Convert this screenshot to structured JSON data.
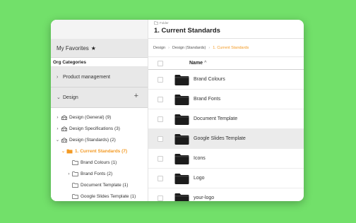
{
  "sidebar": {
    "favorites_label": "My Favorites",
    "org_categories": "Org Categories",
    "sections": [
      {
        "label": "Product management",
        "expanded": false
      },
      {
        "label": "Design",
        "expanded": true
      }
    ],
    "tree": [
      {
        "label": "Design (General) (9)",
        "level": 0,
        "chevron": "right",
        "icon": "library-icon"
      },
      {
        "label": "Design Specifications (3)",
        "level": 0,
        "chevron": "right",
        "icon": "library-icon"
      },
      {
        "label": "Design (Standards) (2)",
        "level": 0,
        "chevron": "down",
        "icon": "library-icon"
      },
      {
        "label": "1. Current Standards (7)",
        "level": 1,
        "chevron": "down",
        "icon": "folder-filled-icon",
        "active": true
      },
      {
        "label": "Brand Colours (1)",
        "level": 2,
        "chevron": "",
        "icon": "folder-outline-icon"
      },
      {
        "label": "Brand Fonts (2)",
        "level": 2,
        "chevron": "right",
        "icon": "folder-outline-icon"
      },
      {
        "label": "Document Template (1)",
        "level": 2,
        "chevron": "",
        "icon": "folder-outline-icon"
      },
      {
        "label": "Google Slides Template (1)",
        "level": 2,
        "chevron": "",
        "icon": "folder-outline-icon"
      }
    ]
  },
  "main": {
    "kind": "Folder",
    "title": "1. Current Standards",
    "breadcrumb": [
      "Design",
      "Design (Standards)",
      "1. Current Standards"
    ],
    "column_name": "Name",
    "sort_indicator": "^",
    "rows": [
      {
        "name": "Brand Colours",
        "highlighted": false
      },
      {
        "name": "Brand Fonts",
        "highlighted": false
      },
      {
        "name": "Document Template",
        "highlighted": false
      },
      {
        "name": "Google Slides Template",
        "highlighted": true
      },
      {
        "name": "Icons",
        "highlighted": false
      },
      {
        "name": "Logo",
        "highlighted": false
      },
      {
        "name": "your-logo",
        "highlighted": false
      }
    ]
  },
  "colors": {
    "background": "#72e06a",
    "accent": "#f39a24",
    "highlight_row": "#ebebeb"
  }
}
